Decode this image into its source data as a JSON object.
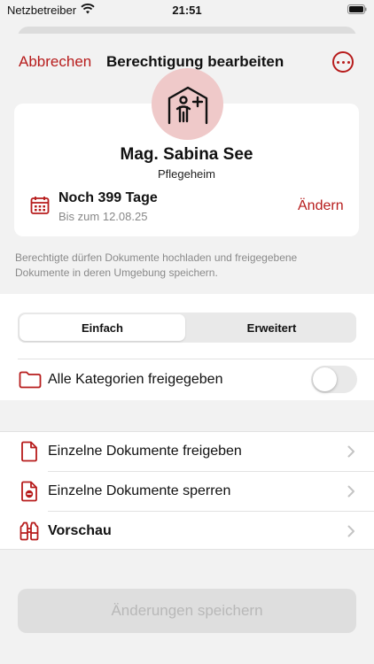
{
  "status_bar": {
    "carrier": "Netzbetreiber",
    "time": "21:51"
  },
  "nav": {
    "cancel": "Abbrechen",
    "title": "Berechtigung bearbeiten",
    "more_icon": "ellipsis-circle-icon"
  },
  "profile": {
    "avatar_icon": "care-home-icon",
    "name": "Mag. Sabina See",
    "role": "Pflegeheim",
    "duration": "Noch 399 Tage",
    "until": "Bis zum 12.08.25",
    "change": "Ändern"
  },
  "info_text": "Berechtigte dürfen Dokumente hochladen und freigegebene Dokumente in deren Umgebung speichern.",
  "segmented": {
    "options": [
      "Einfach",
      "Erweitert"
    ],
    "selected": "Einfach"
  },
  "categories": {
    "label": "Alle Kategorien freigegeben",
    "enabled": false
  },
  "list": [
    {
      "label": "Einzelne Dokumente freigeben",
      "icon": "document-icon"
    },
    {
      "label": "Einzelne Dokumente sperren",
      "icon": "document-blocked-icon"
    },
    {
      "label": "Vorschau",
      "icon": "binoculars-icon"
    }
  ],
  "save_button": "Änderungen speichern",
  "colors": {
    "accent": "#b71c1c",
    "avatar_bg": "#efc9c9",
    "background": "#f2f2f2"
  }
}
